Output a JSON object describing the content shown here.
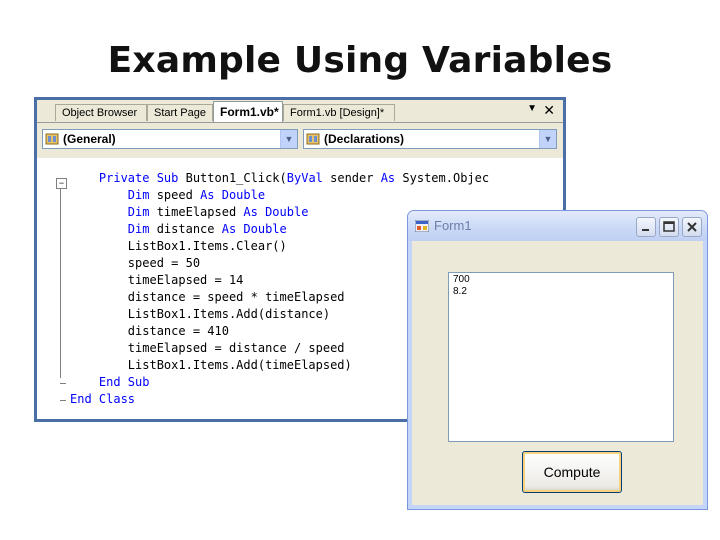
{
  "slide": {
    "title": "Example Using Variables"
  },
  "editor": {
    "tabs": [
      {
        "label": "Object Browser",
        "active": false
      },
      {
        "label": "Start Page",
        "active": false
      },
      {
        "label": "Form1.vb*",
        "active": true
      },
      {
        "label": "Form1.vb [Design]*",
        "active": false
      }
    ],
    "tab_menu_icon": "chevron-down-icon",
    "tab_close_icon": "close-icon",
    "class_combo": {
      "value": "(General)"
    },
    "method_combo": {
      "value": "(Declarations)"
    },
    "code_lines": [
      {
        "indent": "    ",
        "parts": [
          {
            "t": "Private Sub ",
            "kw": true
          },
          {
            "t": "Button1_Click(",
            "kw": false
          },
          {
            "t": "ByVal ",
            "kw": true
          },
          {
            "t": "sender ",
            "kw": false
          },
          {
            "t": "As ",
            "kw": true
          },
          {
            "t": "System.Objec",
            "kw": false
          }
        ]
      },
      {
        "indent": "        ",
        "parts": [
          {
            "t": "Dim ",
            "kw": true
          },
          {
            "t": "speed ",
            "kw": false
          },
          {
            "t": "As Double",
            "kw": true
          }
        ]
      },
      {
        "indent": "        ",
        "parts": [
          {
            "t": "Dim ",
            "kw": true
          },
          {
            "t": "timeElapsed ",
            "kw": false
          },
          {
            "t": "As Double",
            "kw": true
          }
        ]
      },
      {
        "indent": "        ",
        "parts": [
          {
            "t": "Dim ",
            "kw": true
          },
          {
            "t": "distance ",
            "kw": false
          },
          {
            "t": "As Double",
            "kw": true
          }
        ]
      },
      {
        "indent": "        ",
        "parts": [
          {
            "t": "ListBox1.Items.Clear()",
            "kw": false
          }
        ]
      },
      {
        "indent": "        ",
        "parts": [
          {
            "t": "speed = 50",
            "kw": false
          }
        ]
      },
      {
        "indent": "        ",
        "parts": [
          {
            "t": "timeElapsed = 14",
            "kw": false
          }
        ]
      },
      {
        "indent": "        ",
        "parts": [
          {
            "t": "distance = speed * timeElapsed",
            "kw": false
          }
        ]
      },
      {
        "indent": "        ",
        "parts": [
          {
            "t": "ListBox1.Items.Add(distance)",
            "kw": false
          }
        ]
      },
      {
        "indent": "        ",
        "parts": [
          {
            "t": "distance = 410",
            "kw": false
          }
        ]
      },
      {
        "indent": "        ",
        "parts": [
          {
            "t": "timeElapsed = distance / speed",
            "kw": false
          }
        ]
      },
      {
        "indent": "        ",
        "parts": [
          {
            "t": "ListBox1.Items.Add(timeElapsed)",
            "kw": false
          }
        ]
      },
      {
        "indent": "    ",
        "parts": [
          {
            "t": "End Sub",
            "kw": true
          }
        ]
      },
      {
        "indent": "",
        "parts": [
          {
            "t": "End Class",
            "kw": true
          }
        ]
      }
    ]
  },
  "form": {
    "title": "Form1",
    "list_items": [
      "700",
      "8.2"
    ],
    "compute_label": "Compute"
  },
  "colors": {
    "keyword": "#0000ff",
    "editor_frame": "#4a6fa6"
  }
}
